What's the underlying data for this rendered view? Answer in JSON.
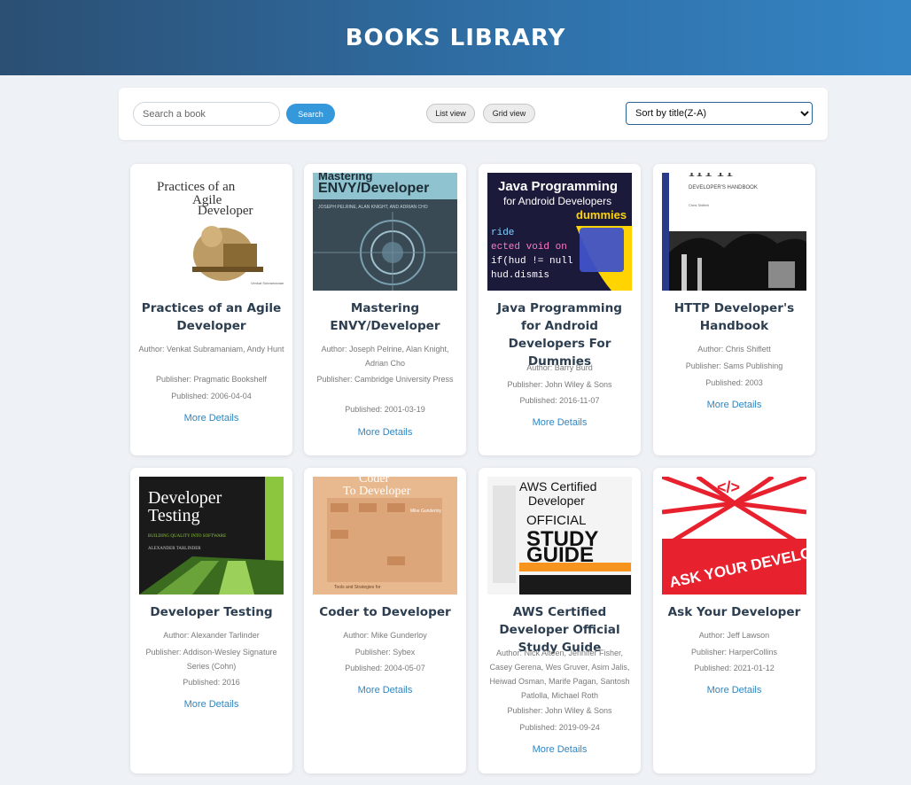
{
  "header": {
    "title": "BOOKS LIBRARY"
  },
  "controls": {
    "search_placeholder": "Search a book",
    "search_label": "Search",
    "list_view_label": "List view",
    "grid_view_label": "Grid view",
    "sort_selected": "Sort by title(Z-A)"
  },
  "books": [
    {
      "title": "Practices of an Agile Developer",
      "author": "Author: Venkat Subramaniam, Andy Hunt",
      "publisher": "Publisher: Pragmatic Bookshelf",
      "published": "Published: 2006-04-04",
      "link": "More Details",
      "cover": {
        "icon": "agile-developer-cover",
        "text": [
          "Practices of an",
          "Agile",
          "Developer"
        ],
        "bg": "#ffffff",
        "fg": "#333333"
      }
    },
    {
      "title": "Mastering ENVY/Developer",
      "author": "Author: Joseph Pelrine, Alan Knight, Adrian Cho",
      "publisher": "Publisher: Cambridge University Press",
      "published": "Published: 2001-03-19",
      "link": "More Details",
      "cover": {
        "icon": "envy-developer-cover",
        "text": [
          "Mastering",
          "ENVY/Developer",
          "JOSEPH PELRINE, ALAN KNIGHT, AND ADRIAN CHO"
        ],
        "bg": "#3a4a55",
        "fg": "#ffffff"
      }
    },
    {
      "title": "Java Programming for Android Developers For Dummies",
      "author": "Author: Barry Burd",
      "publisher": "Publisher: John Wiley & Sons",
      "published": "Published: 2016-11-07",
      "link": "More Details",
      "cover": {
        "icon": "java-dummies-cover",
        "text": [
          "Java Programming",
          "for Android Developers",
          "dummies",
          "ride",
          "ected void on",
          "if(hud != null",
          "hud.dismis"
        ],
        "bg": "#1c1a3a",
        "fg": "#ffffff"
      }
    },
    {
      "title": "HTTP Developer's Handbook",
      "author": "Author: Chris Shiflett",
      "publisher": "Publisher: Sams Publishing",
      "published": "Published: 2003",
      "link": "More Details",
      "cover": {
        "icon": "http-handbook-cover",
        "text": [
          "HTTP",
          "DEVELOPER'S HANDBOOK",
          "Chris Shiflett"
        ],
        "bg": "#ffffff",
        "fg": "#222222"
      }
    },
    {
      "title": "Developer Testing",
      "author": "Author: Alexander Tarlinder",
      "publisher": "Publisher: Addison-Wesley Signature Series (Cohn)",
      "published": "Published: 2016",
      "link": "More Details",
      "cover": {
        "icon": "developer-testing-cover",
        "text": [
          "Developer",
          "Testing",
          "BUILDING QUALITY INTO SOFTWARE",
          "ALEXANDER TARLINDER"
        ],
        "bg": "#1a1a1a",
        "fg": "#ffffff"
      }
    },
    {
      "title": "Coder to Developer",
      "author": "Author: Mike Gunderloy",
      "publisher": "Publisher: Sybex",
      "published": "Published: 2004-05-07",
      "link": "More Details",
      "cover": {
        "icon": "coder-to-developer-cover",
        "text": [
          "Coder",
          "To Developer",
          "Mike Gunderloy",
          "Tools and Strategies for"
        ],
        "bg": "#e8b98f",
        "fg": "#ffffff"
      }
    },
    {
      "title": "AWS Certified Developer Official Study Guide",
      "author": "Author: Nick Alteen, Jennifer Fisher, Casey Gerena, Wes Gruver, Asim Jalis, Heiwad Osman, Marife Pagan, Santosh Patlolla, Michael Roth",
      "publisher": "Publisher: John Wiley & Sons",
      "published": "Published: 2019-09-24",
      "link": "More Details",
      "cover": {
        "icon": "aws-study-guide-cover",
        "text": [
          "AWS Certified",
          "Developer",
          "OFFICIAL",
          "STUDY",
          "GUIDE"
        ],
        "bg": "#f4f4f4",
        "fg": "#111111"
      }
    },
    {
      "title": "Ask Your Developer",
      "author": "Author: Jeff Lawson",
      "publisher": "Publisher: HarperCollins",
      "published": "Published: 2021-01-12",
      "link": "More Details",
      "cover": {
        "icon": "ask-your-developer-cover",
        "text": [
          "</>",
          "ASK YOUR DEVELOPER"
        ],
        "bg": "#e8212e",
        "fg": "#ffffff"
      }
    }
  ]
}
